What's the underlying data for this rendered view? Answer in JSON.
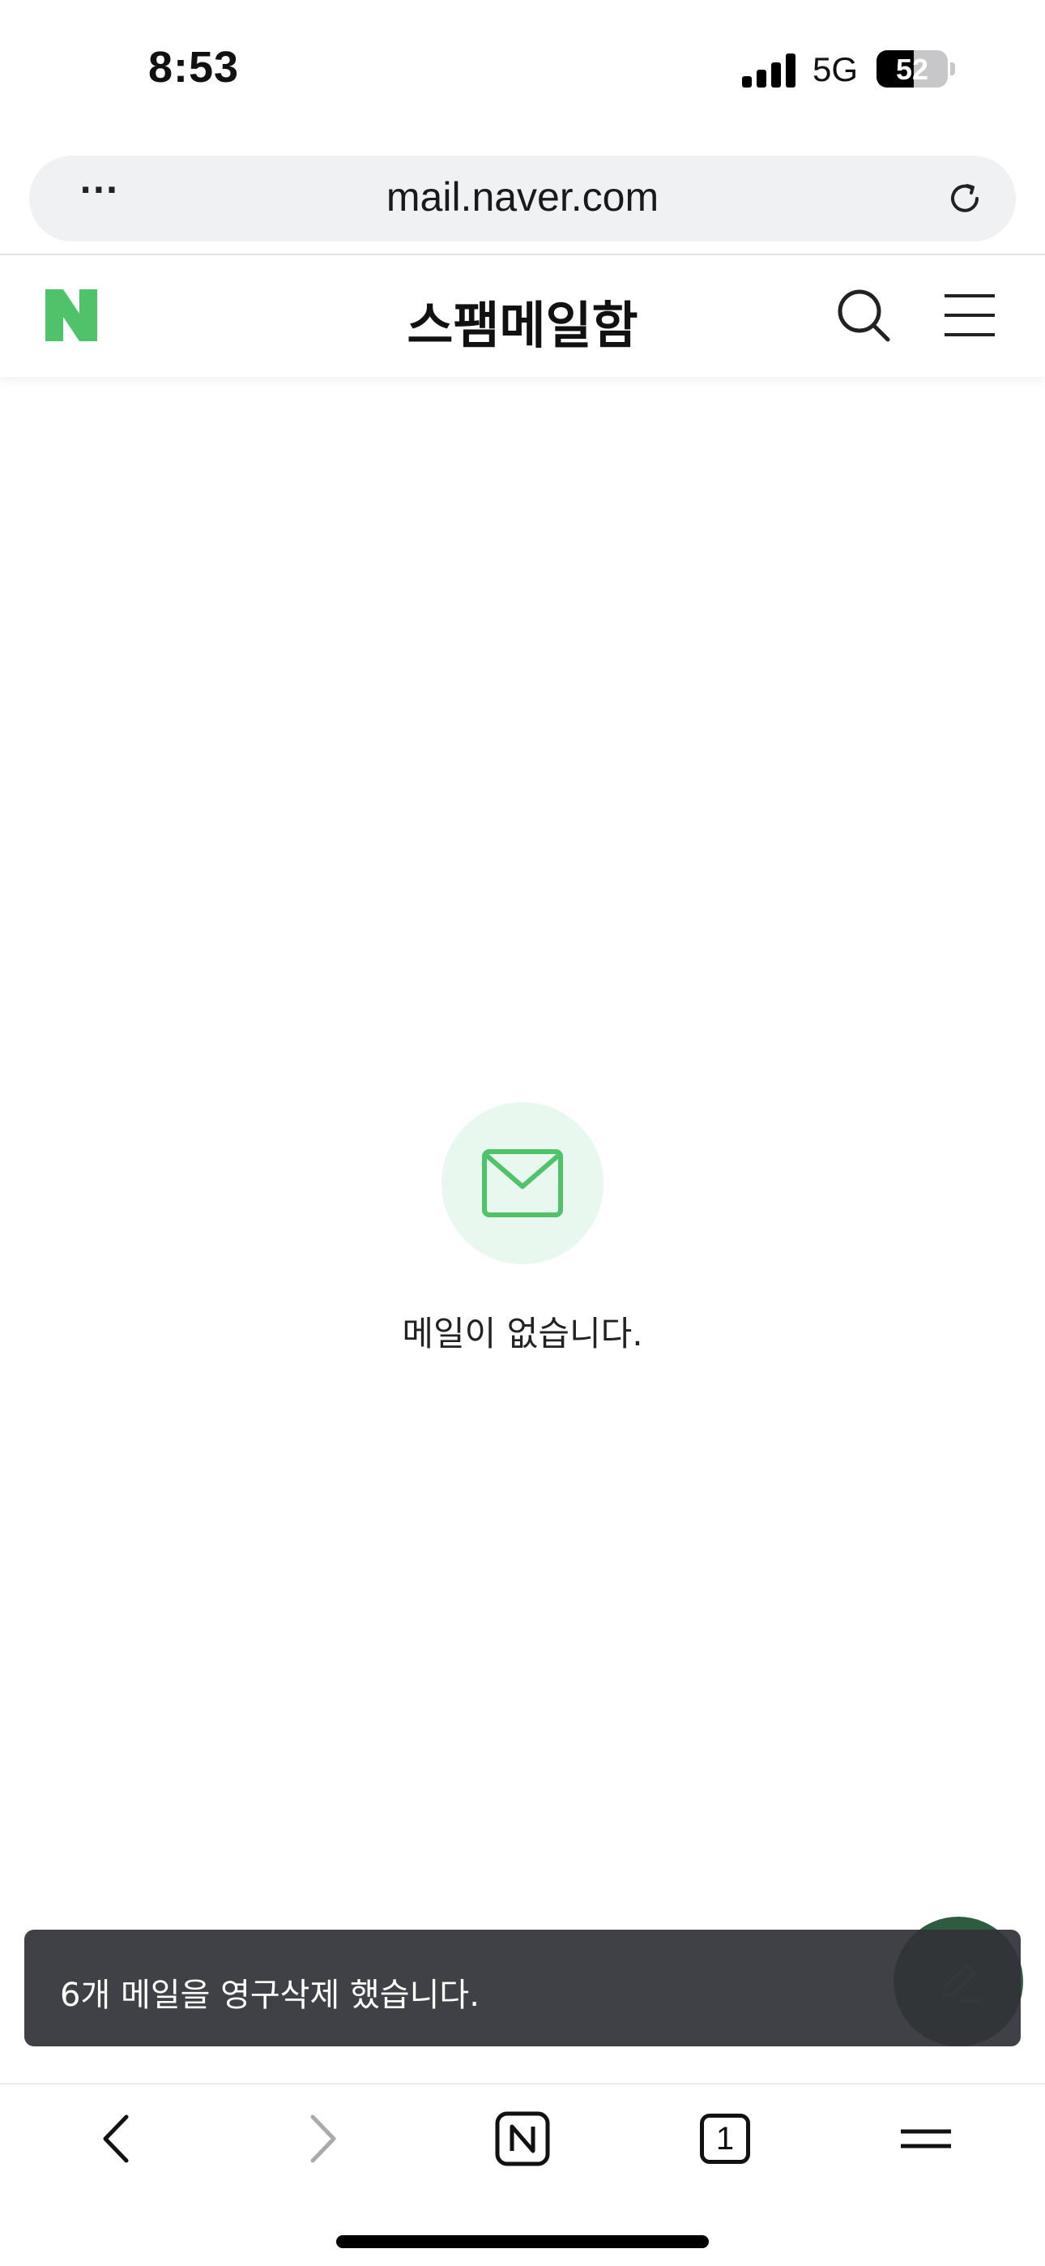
{
  "status_bar": {
    "time": "8:53",
    "network": "5G",
    "battery_level": 52,
    "battery_text": "52"
  },
  "browser": {
    "url": "mail.naver.com",
    "more_label": "···"
  },
  "header": {
    "title": "스팸메일함",
    "logo_icon": "naver-n-logo",
    "brand_color": "#2db400"
  },
  "empty_state": {
    "icon": "envelope-icon",
    "message": "메일이 없습니다.",
    "icon_color": "#4fc26a",
    "circle_color": "#e9f8ee"
  },
  "toast": {
    "message": "6개 메일을 영구삭제 했습니다."
  },
  "toolbar": {
    "tab_count": "1"
  }
}
